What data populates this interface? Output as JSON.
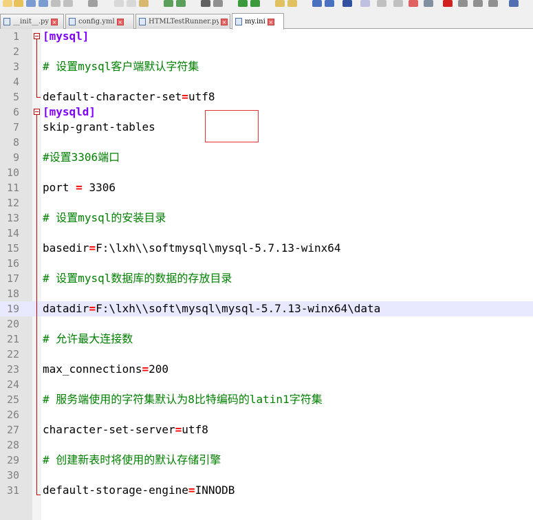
{
  "tabs": [
    {
      "label": "__init__.py",
      "active": false
    },
    {
      "label": "config.yml",
      "active": false
    },
    {
      "label": "HTMLTestRunner.py",
      "active": false
    },
    {
      "label": "my.ini",
      "active": true
    }
  ],
  "editor": {
    "highlighted_line": 19,
    "lines": [
      {
        "n": "1",
        "parts": [
          {
            "t": "[mysql]",
            "c": "sec"
          }
        ]
      },
      {
        "n": "2",
        "parts": []
      },
      {
        "n": "3",
        "parts": [
          {
            "t": "# 设置mysql客户端默认字符集",
            "c": "cmt"
          }
        ]
      },
      {
        "n": "4",
        "parts": []
      },
      {
        "n": "5",
        "parts": [
          {
            "t": "default-character-set",
            "c": "val"
          },
          {
            "t": "=",
            "c": "eq"
          },
          {
            "t": "utf8",
            "c": "val"
          }
        ]
      },
      {
        "n": "6",
        "parts": [
          {
            "t": "[mysqld]",
            "c": "sec"
          }
        ]
      },
      {
        "n": "7",
        "parts": [
          {
            "t": "skip-grant-tables",
            "c": "val"
          }
        ]
      },
      {
        "n": "8",
        "parts": []
      },
      {
        "n": "9",
        "parts": [
          {
            "t": "#设置3306端口",
            "c": "cmt"
          }
        ]
      },
      {
        "n": "10",
        "parts": []
      },
      {
        "n": "11",
        "parts": [
          {
            "t": "port ",
            "c": "val"
          },
          {
            "t": "=",
            "c": "eq"
          },
          {
            "t": " 3306",
            "c": "val"
          }
        ]
      },
      {
        "n": "12",
        "parts": []
      },
      {
        "n": "13",
        "parts": [
          {
            "t": "# 设置mysql的安装目录",
            "c": "cmt"
          }
        ]
      },
      {
        "n": "14",
        "parts": []
      },
      {
        "n": "15",
        "parts": [
          {
            "t": "basedir",
            "c": "val"
          },
          {
            "t": "=",
            "c": "eq"
          },
          {
            "t": "F:\\lxh\\\\softmysql\\mysql-5.7.13-winx64",
            "c": "val"
          }
        ]
      },
      {
        "n": "16",
        "parts": []
      },
      {
        "n": "17",
        "parts": [
          {
            "t": "# 设置mysql数据库的数据的存放目录",
            "c": "cmt"
          }
        ]
      },
      {
        "n": "18",
        "parts": []
      },
      {
        "n": "19",
        "parts": [
          {
            "t": "datadir",
            "c": "val"
          },
          {
            "t": "=",
            "c": "eq"
          },
          {
            "t": "F:\\lxh\\\\soft\\mysql\\mysql-5.7.13-winx64\\data",
            "c": "val"
          }
        ]
      },
      {
        "n": "20",
        "parts": []
      },
      {
        "n": "21",
        "parts": [
          {
            "t": "# 允许最大连接数",
            "c": "cmt"
          }
        ]
      },
      {
        "n": "22",
        "parts": []
      },
      {
        "n": "23",
        "parts": [
          {
            "t": "max_connections",
            "c": "val"
          },
          {
            "t": "=",
            "c": "eq"
          },
          {
            "t": "200",
            "c": "val"
          }
        ]
      },
      {
        "n": "24",
        "parts": []
      },
      {
        "n": "25",
        "parts": [
          {
            "t": "# 服务端使用的字符集默认为8比特编码的latin1字符集",
            "c": "cmt"
          }
        ]
      },
      {
        "n": "26",
        "parts": []
      },
      {
        "n": "27",
        "parts": [
          {
            "t": "character-set-server",
            "c": "val"
          },
          {
            "t": "=",
            "c": "eq"
          },
          {
            "t": "utf8",
            "c": "val"
          }
        ]
      },
      {
        "n": "28",
        "parts": []
      },
      {
        "n": "29",
        "parts": [
          {
            "t": "# 创建新表时将使用的默认存储引擎",
            "c": "cmt"
          }
        ]
      },
      {
        "n": "30",
        "parts": []
      },
      {
        "n": "31",
        "parts": [
          {
            "t": "default-storage-engine",
            "c": "val"
          },
          {
            "t": "=",
            "c": "eq"
          },
          {
            "t": "INNODB",
            "c": "val"
          }
        ]
      }
    ]
  },
  "colors": {
    "section": "#8000ff",
    "comment": "#008000",
    "operator": "#ff0000",
    "highlight": "#e8e8ff",
    "annotation_box": "#e03030"
  }
}
